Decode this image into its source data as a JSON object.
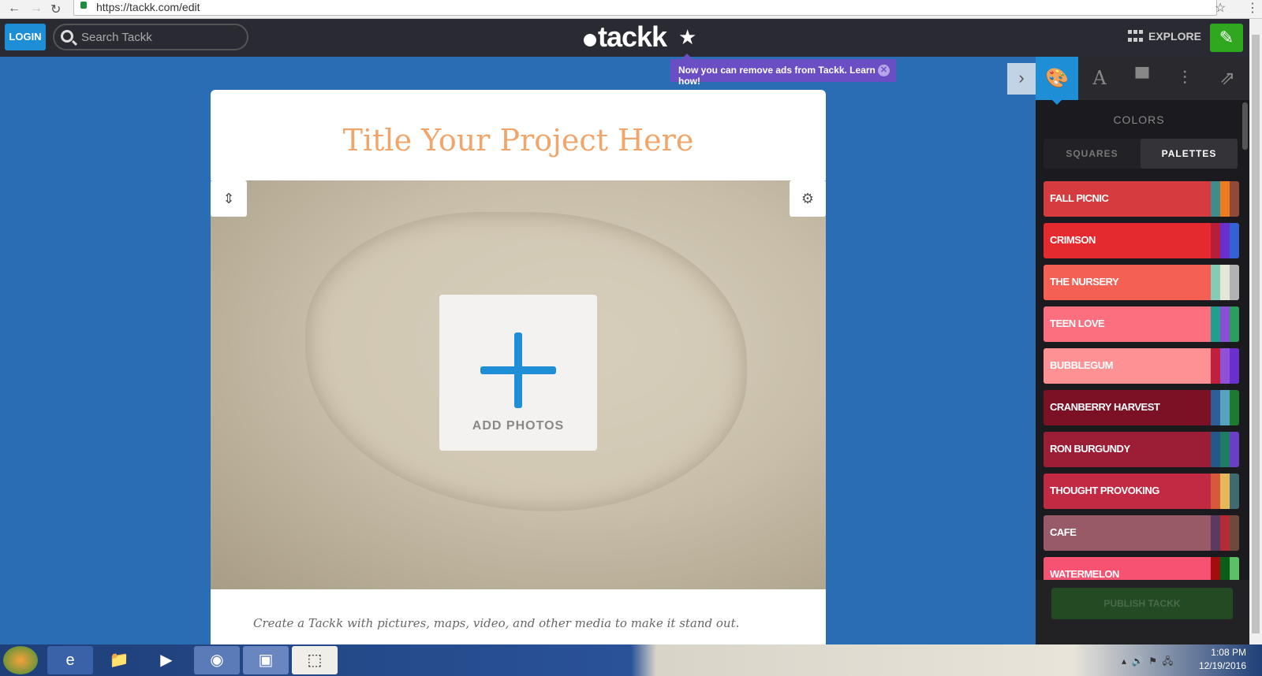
{
  "browser": {
    "url": "https://tackk.com/edit"
  },
  "topbar": {
    "login": "LOGIN",
    "search_placeholder": "Search Tackk",
    "logo": "tackk",
    "explore": "EXPLORE"
  },
  "toast": {
    "text": "Now you can remove ads from Tackk. Learn how!"
  },
  "card": {
    "title": "Title Your Project Here",
    "add_photos": "ADD PHOTOS",
    "caption": "Create a Tackk with pictures, maps, video, and other media to make it stand out."
  },
  "panel": {
    "heading": "COLORS",
    "seg": [
      "SQUARES",
      "PALETTES"
    ],
    "publish": "PUBLISH TACKK",
    "palettes": [
      {
        "name": "FALL PICNIC",
        "color": "#d63c3f",
        "swatches": [
          "#3f8c8c",
          "#ef7b20",
          "#8f4a38"
        ]
      },
      {
        "name": "CRIMSON",
        "color": "#e52a2f",
        "swatches": [
          "#b81e3a",
          "#6a2fcf",
          "#3262d4"
        ]
      },
      {
        "name": "THE NURSERY",
        "color": "#f46154",
        "swatches": [
          "#86cbb6",
          "#e6e6d6",
          "#b2b2b2"
        ]
      },
      {
        "name": "TEEN LOVE",
        "color": "#fb6f7e",
        "swatches": [
          "#1f9f8f",
          "#8a4fd4",
          "#2a9d5f"
        ]
      },
      {
        "name": "BUBBLEGUM",
        "color": "#fd9193",
        "swatches": [
          "#c0203c",
          "#9050d8",
          "#6a2fcf"
        ]
      },
      {
        "name": "CRANBERRY HARVEST",
        "color": "#7c1024",
        "swatches": [
          "#2c5e9a",
          "#56a2c0",
          "#1e7a2f"
        ]
      },
      {
        "name": "RON BURGUNDY",
        "color": "#9b1e36",
        "swatches": [
          "#24578a",
          "#1e7d63",
          "#6a3fc4"
        ]
      },
      {
        "name": "THOUGHT PROVOKING",
        "color": "#c22a44",
        "swatches": [
          "#d55a3a",
          "#e6b85a",
          "#3e6a70"
        ]
      },
      {
        "name": "CAFE",
        "color": "#985a66",
        "swatches": [
          "#5a3a5e",
          "#b52a34",
          "#6e4a3e"
        ]
      },
      {
        "name": "WATERMELON",
        "color": "#f85273",
        "swatches": [
          "#a00e0e",
          "#0a5e18",
          "#5cc066"
        ]
      }
    ]
  },
  "taskbar": {
    "time": "1:08 PM",
    "date": "12/19/2016"
  }
}
